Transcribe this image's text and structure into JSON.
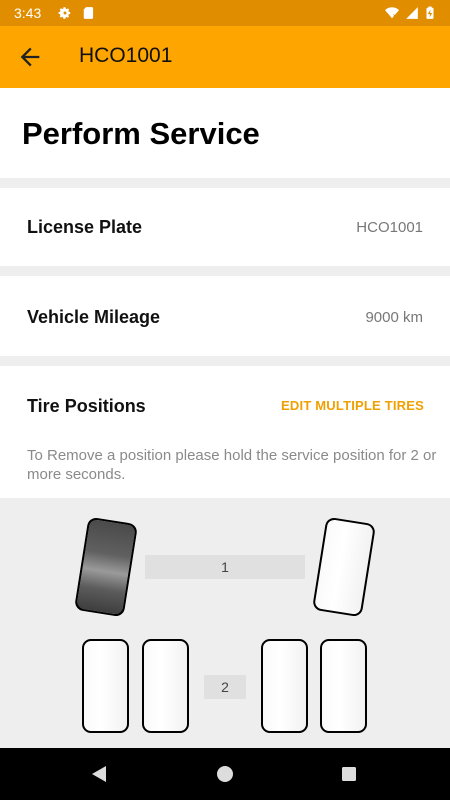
{
  "status_bar": {
    "time": "3:43"
  },
  "toolbar": {
    "title": "HCO1001"
  },
  "page": {
    "heading": "Perform Service"
  },
  "license_plate": {
    "label": "License Plate",
    "value": "HCO1001"
  },
  "vehicle_mileage": {
    "label": "Vehicle Mileage",
    "value": "9000 km"
  },
  "tire_positions": {
    "label": "Tire Positions",
    "edit_button": "EDIT MULTIPLE TIRES",
    "note": "To Remove a position please hold the service position for 2 or more seconds."
  },
  "axles": [
    {
      "label": "1"
    },
    {
      "label": "2"
    }
  ]
}
